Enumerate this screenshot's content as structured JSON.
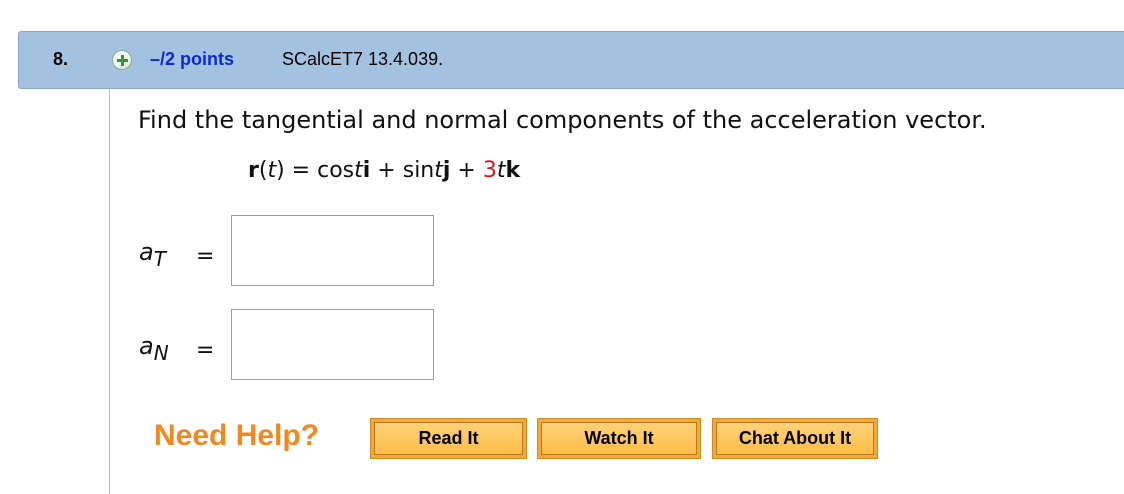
{
  "question": {
    "number": "8.",
    "points": "–/2 points",
    "code": "SCalcET7 13.4.039."
  },
  "prompt": "Find the tangential and normal components of the acceleration vector.",
  "formula": {
    "r": "r",
    "open_paren": "(",
    "t": "t",
    "close_paren_eq": ") = cos",
    "t1": "t",
    "i": "i",
    "plus1": " + sin",
    "t2": "t",
    "j": "j",
    "plus2": " + ",
    "coef": "3",
    "t3": "t",
    "k": "k"
  },
  "answers": [
    {
      "label_main": "a",
      "label_sub": "T",
      "eq": "=",
      "value": ""
    },
    {
      "label_main": "a",
      "label_sub": "N",
      "eq": "=",
      "value": ""
    }
  ],
  "help": {
    "title": "Need Help?",
    "buttons": [
      "Read It",
      "Watch It",
      "Chat About It"
    ]
  },
  "colors": {
    "header_bg": "#a3c2df",
    "points_blue": "#0e28d9",
    "help_orange": "#f5871f",
    "coef_red": "#e41414"
  }
}
